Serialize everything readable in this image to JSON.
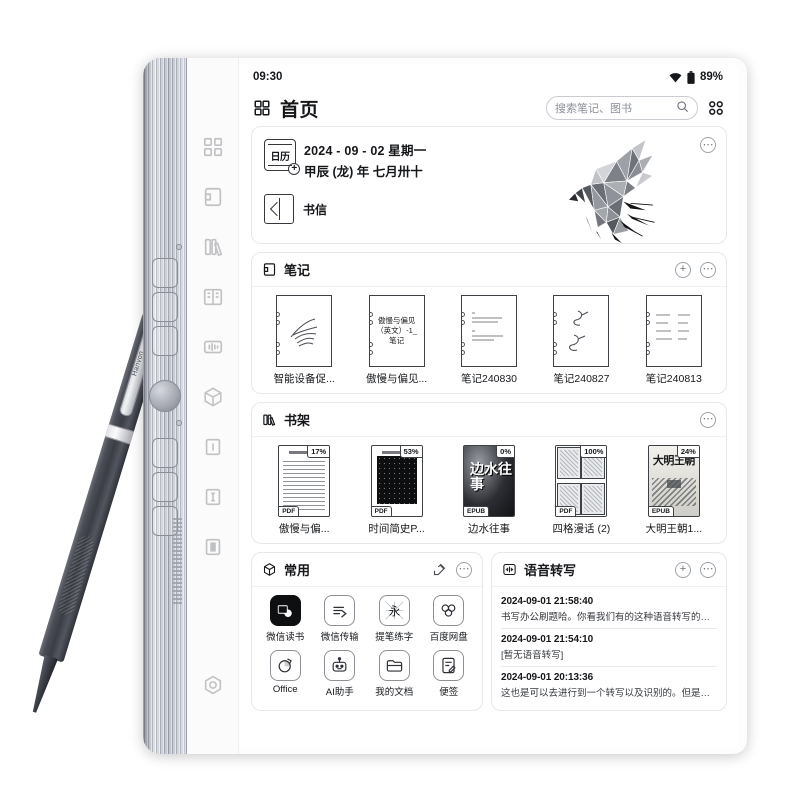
{
  "device": {
    "brand": "Hanvon"
  },
  "status_bar": {
    "time": "09:30",
    "battery_percent": "89%",
    "wifi_icon": "wifi-icon",
    "battery_icon": "battery-icon"
  },
  "top_bar": {
    "grid_icon": "grid-icon",
    "title": "首页",
    "search": {
      "placeholder": "搜索笔记、图书",
      "icon": "search-icon"
    },
    "apps_icon": "apps-grid-icon"
  },
  "calendar_card": {
    "icon_label": "日历",
    "date_line": "2024 - 09 - 02 星期一",
    "lunar_line": "甲辰 (龙) 年 七月卅十",
    "letter_label": "书信",
    "letter_icon": "letter-book-icon",
    "more_icon": "more-icon",
    "illustration": "low-poly-bird-illustration"
  },
  "notes_card": {
    "title": "笔记",
    "icon": "notebook-icon",
    "add_icon": "plus-icon",
    "more_icon": "more-icon",
    "items": [
      {
        "title": "智能设备促...",
        "preview_kind": "scribble",
        "preview_text": ""
      },
      {
        "title": "傲慢与偏见...",
        "preview_kind": "text",
        "preview_text": "傲慢与偏见（英文）-1_笔记"
      },
      {
        "title": "笔记240830",
        "preview_kind": "lines",
        "preview_text": ""
      },
      {
        "title": "笔记240827",
        "preview_kind": "scribble2",
        "preview_text": ""
      },
      {
        "title": "笔记240813",
        "preview_kind": "table",
        "preview_text": ""
      }
    ]
  },
  "bookshelf_card": {
    "title": "书架",
    "icon": "bookshelf-icon",
    "more_icon": "more-icon",
    "items": [
      {
        "title": "傲慢与偏...",
        "progress": "17%",
        "format": "PDF",
        "art": "text-page"
      },
      {
        "title": "时间简史P...",
        "progress": "53%",
        "format": "PDF",
        "art": "dark-cover"
      },
      {
        "title": "边水往事",
        "progress": "0%",
        "format": "EPUB",
        "art": "photo-cover",
        "cover_text": "边水往事"
      },
      {
        "title": "四格漫话 (2)",
        "progress": "100%",
        "format": "PDF",
        "art": "manga-grid"
      },
      {
        "title": "大明王朝1...",
        "progress": "24%",
        "format": "EPUB",
        "art": "ming-cover",
        "cover_text": "大明王朝"
      }
    ]
  },
  "apps_card": {
    "title": "常用",
    "icon": "hexagon-icon",
    "edit_icon": "edit-icon",
    "more_icon": "more-icon",
    "items": [
      {
        "label": "微信读书",
        "icon": "wechat-read-icon"
      },
      {
        "label": "微信传输",
        "icon": "wechat-transfer-icon"
      },
      {
        "label": "提笔练字",
        "icon": "handwriting-practice-icon"
      },
      {
        "label": "百度网盘",
        "icon": "baidu-netdisk-icon"
      },
      {
        "label": "Office",
        "icon": "office-icon"
      },
      {
        "label": "AI助手",
        "icon": "ai-assistant-icon"
      },
      {
        "label": "我的文档",
        "icon": "my-documents-icon"
      },
      {
        "label": "便签",
        "icon": "sticky-note-icon"
      }
    ]
  },
  "voice_card": {
    "title": "语音转写",
    "icon": "voice-icon",
    "add_icon": "plus-icon",
    "more_icon": "more-icon",
    "items": [
      {
        "time": "2024-09-01 21:58:40",
        "text": "书写办公刷题哈。你看我们有的这种语音转写的…"
      },
      {
        "time": "2024-09-01 21:54:10",
        "text": "[暂无语音转写]"
      },
      {
        "time": "2024-09-01 20:13:36",
        "text": "这也是可以去进行到一个转写以及识别的。但是…"
      }
    ]
  },
  "sidebar": {
    "items": [
      {
        "name": "sidebar-item-home",
        "icon": "grid-icon"
      },
      {
        "name": "sidebar-item-notes",
        "icon": "notebook-icon"
      },
      {
        "name": "sidebar-item-bookshelf",
        "icon": "bookshelf-icon"
      },
      {
        "name": "sidebar-item-library",
        "icon": "open-book-icon"
      },
      {
        "name": "sidebar-item-audio",
        "icon": "audio-icon"
      },
      {
        "name": "sidebar-item-apps",
        "icon": "hexagon-icon"
      },
      {
        "name": "sidebar-item-doc1",
        "icon": "document-icon"
      },
      {
        "name": "sidebar-item-doc2",
        "icon": "document-icon"
      },
      {
        "name": "sidebar-item-doc3",
        "icon": "document-icon"
      },
      {
        "name": "sidebar-item-settings",
        "icon": "gear-icon"
      }
    ]
  }
}
